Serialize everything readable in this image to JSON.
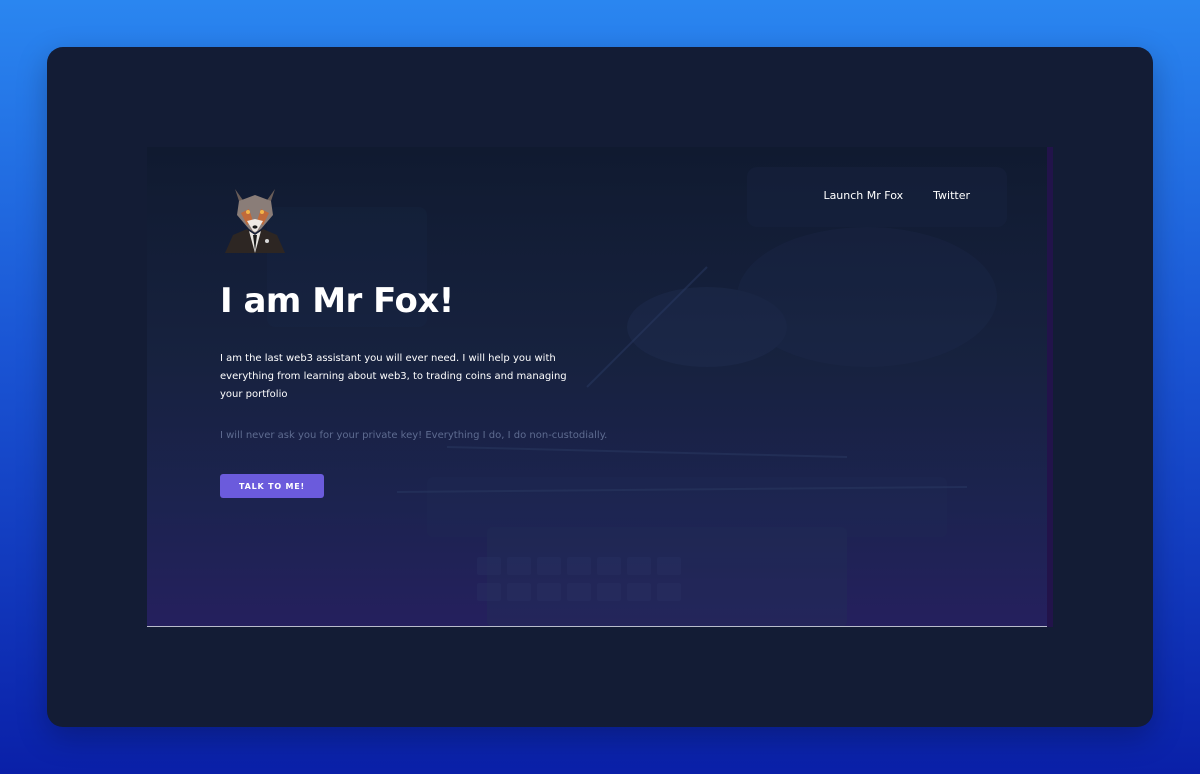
{
  "nav": {
    "launch_label": "Launch Mr Fox",
    "twitter_label": "Twitter"
  },
  "hero": {
    "title": "I am Mr Fox!",
    "intro": "I am the last web3 assistant you will ever need. I will help you with everything from learning about web3, to trading coins and managing your portfolio",
    "disclaimer": "I will never ask you for your private key! Everything I do, I do non-custodially.",
    "cta_label": "TALK TO ME!"
  },
  "colors": {
    "outer_bg_top": "#2a86f0",
    "outer_bg_bottom": "#0a20a8",
    "frame_bg": "#131c35",
    "hero_bg": "#17223f",
    "accent": "#6b5bdc",
    "muted_text": "#5e6b90"
  },
  "icons": {
    "logo": "fox-in-suit-avatar"
  }
}
